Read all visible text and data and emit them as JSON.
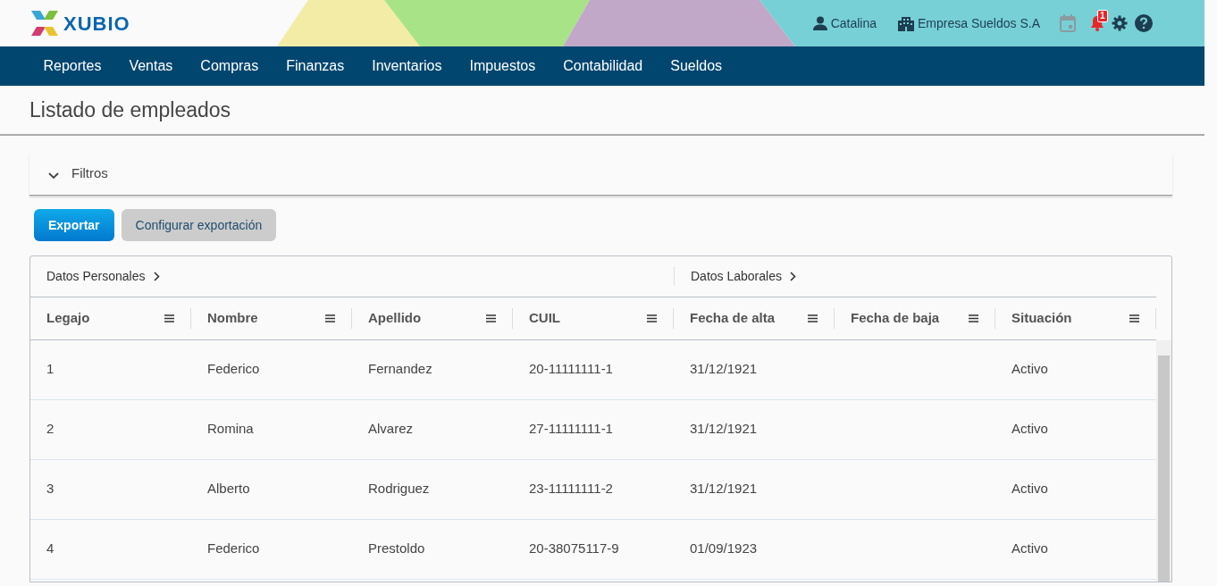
{
  "brand": {
    "name": "XUBIO"
  },
  "user": {
    "name": "Catalina",
    "company": "Empresa Sueldos S.A",
    "notifications": "1"
  },
  "nav": [
    {
      "label": "Reportes"
    },
    {
      "label": "Ventas"
    },
    {
      "label": "Compras"
    },
    {
      "label": "Finanzas"
    },
    {
      "label": "Inventarios"
    },
    {
      "label": "Impuestos"
    },
    {
      "label": "Contabilidad"
    },
    {
      "label": "Sueldos"
    }
  ],
  "page_title": "Listado de empleados",
  "filters": {
    "label": "Filtros",
    "expanded": false
  },
  "buttons": [
    {
      "label": "Exportar",
      "kind": "primary"
    },
    {
      "label": "Configurar exportación",
      "kind": "secondary"
    }
  ],
  "table": {
    "groups": [
      {
        "label": "Datos Personales",
        "columns": [
          "Legajo",
          "Nombre",
          "Apellido",
          "CUIL"
        ]
      },
      {
        "label": "Datos Laborales",
        "columns": [
          "Fecha de alta",
          "Fecha de baja",
          "Situación"
        ]
      }
    ],
    "rows": [
      [
        "1",
        "Federico",
        "Fernandez",
        "20-11111111-1",
        "31/12/1921",
        "",
        "Activo"
      ],
      [
        "2",
        "Romina",
        "Alvarez",
        "27-11111111-1",
        "31/12/1921",
        "",
        "Activo"
      ],
      [
        "3",
        "Alberto",
        "Rodriguez",
        "23-11111111-2",
        "31/12/1921",
        "",
        "Activo"
      ],
      [
        "4",
        "Federico",
        "Prestoldo",
        "20-38075117-9",
        "01/09/1923",
        "",
        "Activo"
      ]
    ]
  }
}
